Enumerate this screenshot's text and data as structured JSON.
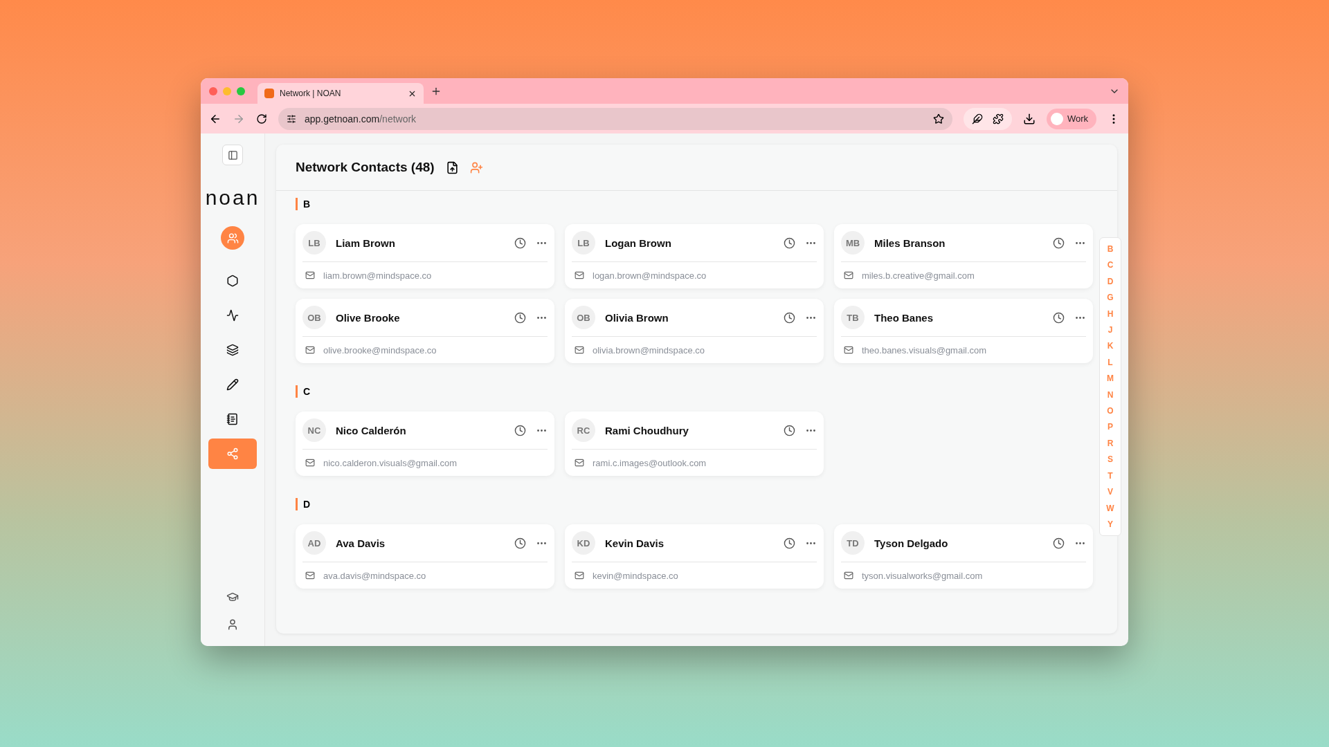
{
  "browser": {
    "tab_title": "Network | NOAN",
    "url": {
      "host": "app.getnoan.com",
      "path": "/network"
    },
    "profile": "Work"
  },
  "sidebar": {
    "logo": "noan",
    "nav": [
      {
        "kind": "hexagon",
        "selected": false
      },
      {
        "kind": "activity",
        "selected": false
      },
      {
        "kind": "layers",
        "selected": false
      },
      {
        "kind": "pencil",
        "selected": false
      },
      {
        "kind": "notebook",
        "selected": false
      },
      {
        "kind": "network",
        "selected": true
      }
    ],
    "bottom": [
      {
        "kind": "graduation"
      },
      {
        "kind": "user"
      }
    ]
  },
  "header": {
    "title": "Network Contacts (48)"
  },
  "groups": [
    {
      "letter": "B",
      "contacts": [
        {
          "initials": "LB",
          "name": "Liam Brown",
          "email": "liam.brown@mindspace.co"
        },
        {
          "initials": "LB",
          "name": "Logan Brown",
          "email": "logan.brown@mindspace.co"
        },
        {
          "initials": "MB",
          "name": "Miles Branson",
          "email": "miles.b.creative@gmail.com"
        },
        {
          "initials": "OB",
          "name": "Olive Brooke",
          "email": "olive.brooke@mindspace.co"
        },
        {
          "initials": "OB",
          "name": "Olivia Brown",
          "email": "olivia.brown@mindspace.co"
        },
        {
          "initials": "TB",
          "name": "Theo Banes",
          "email": "theo.banes.visuals@gmail.com"
        }
      ]
    },
    {
      "letter": "C",
      "contacts": [
        {
          "initials": "NC",
          "name": "Nico Calderón",
          "email": "nico.calderon.visuals@gmail.com"
        },
        {
          "initials": "RC",
          "name": "Rami Choudhury",
          "email": "rami.c.images@outlook.com"
        }
      ]
    },
    {
      "letter": "D",
      "contacts": [
        {
          "initials": "AD",
          "name": "Ava Davis",
          "email": "ava.davis@mindspace.co"
        },
        {
          "initials": "KD",
          "name": "Kevin Davis",
          "email": "kevin@mindspace.co"
        },
        {
          "initials": "TD",
          "name": "Tyson Delgado",
          "email": "tyson.visualworks@gmail.com"
        }
      ]
    }
  ],
  "index": [
    "B",
    "C",
    "D",
    "G",
    "H",
    "J",
    "K",
    "L",
    "M",
    "N",
    "O",
    "P",
    "R",
    "S",
    "T",
    "V",
    "W",
    "Y"
  ]
}
